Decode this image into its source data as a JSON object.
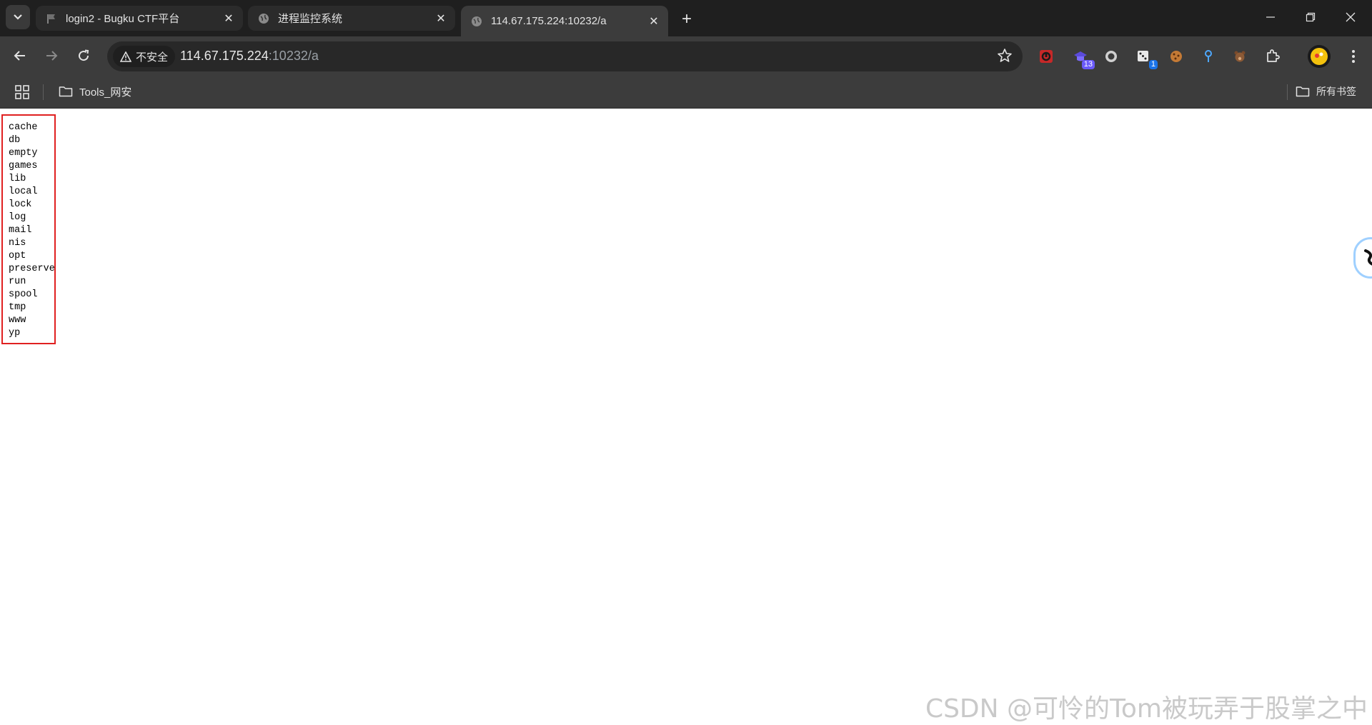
{
  "tabs": [
    {
      "title": "login2 - Bugku CTF平台",
      "state": "inactive",
      "favicon": "flag-icon"
    },
    {
      "title": "进程监控系统",
      "state": "inactive",
      "favicon": "globe-icon"
    },
    {
      "title": "114.67.175.224:10232/a",
      "state": "active",
      "favicon": "globe-icon"
    }
  ],
  "address_bar": {
    "security_label": "不安全",
    "url_host": "114.67.175.224",
    "url_path": ":10232/a"
  },
  "extensions": [
    {
      "name": "red-extension-icon",
      "badge": ""
    },
    {
      "name": "purple-hat-extension-icon",
      "badge": "13"
    },
    {
      "name": "ring-extension-icon",
      "badge": ""
    },
    {
      "name": "dice-extension-icon",
      "badge": "1"
    },
    {
      "name": "cookie-extension-icon",
      "badge": ""
    },
    {
      "name": "pin-extension-icon",
      "badge": ""
    },
    {
      "name": "bear-extension-icon",
      "badge": ""
    }
  ],
  "bookmarks": {
    "folder": "Tools_网安",
    "all_bookmarks": "所有书签"
  },
  "directory_listing": [
    "cache",
    "db",
    "empty",
    "games",
    "lib",
    "local",
    "lock",
    "log",
    "mail",
    "nis",
    "opt",
    "preserve",
    "run",
    "spool",
    "tmp",
    "www",
    "yp"
  ],
  "watermark": "CSDN @可怜的Tom被玩弄于股掌之中",
  "colors": {
    "highlight_border": "#e02020",
    "tab_strip": "#1f1f1f",
    "toolbar": "#3c3c3c"
  }
}
